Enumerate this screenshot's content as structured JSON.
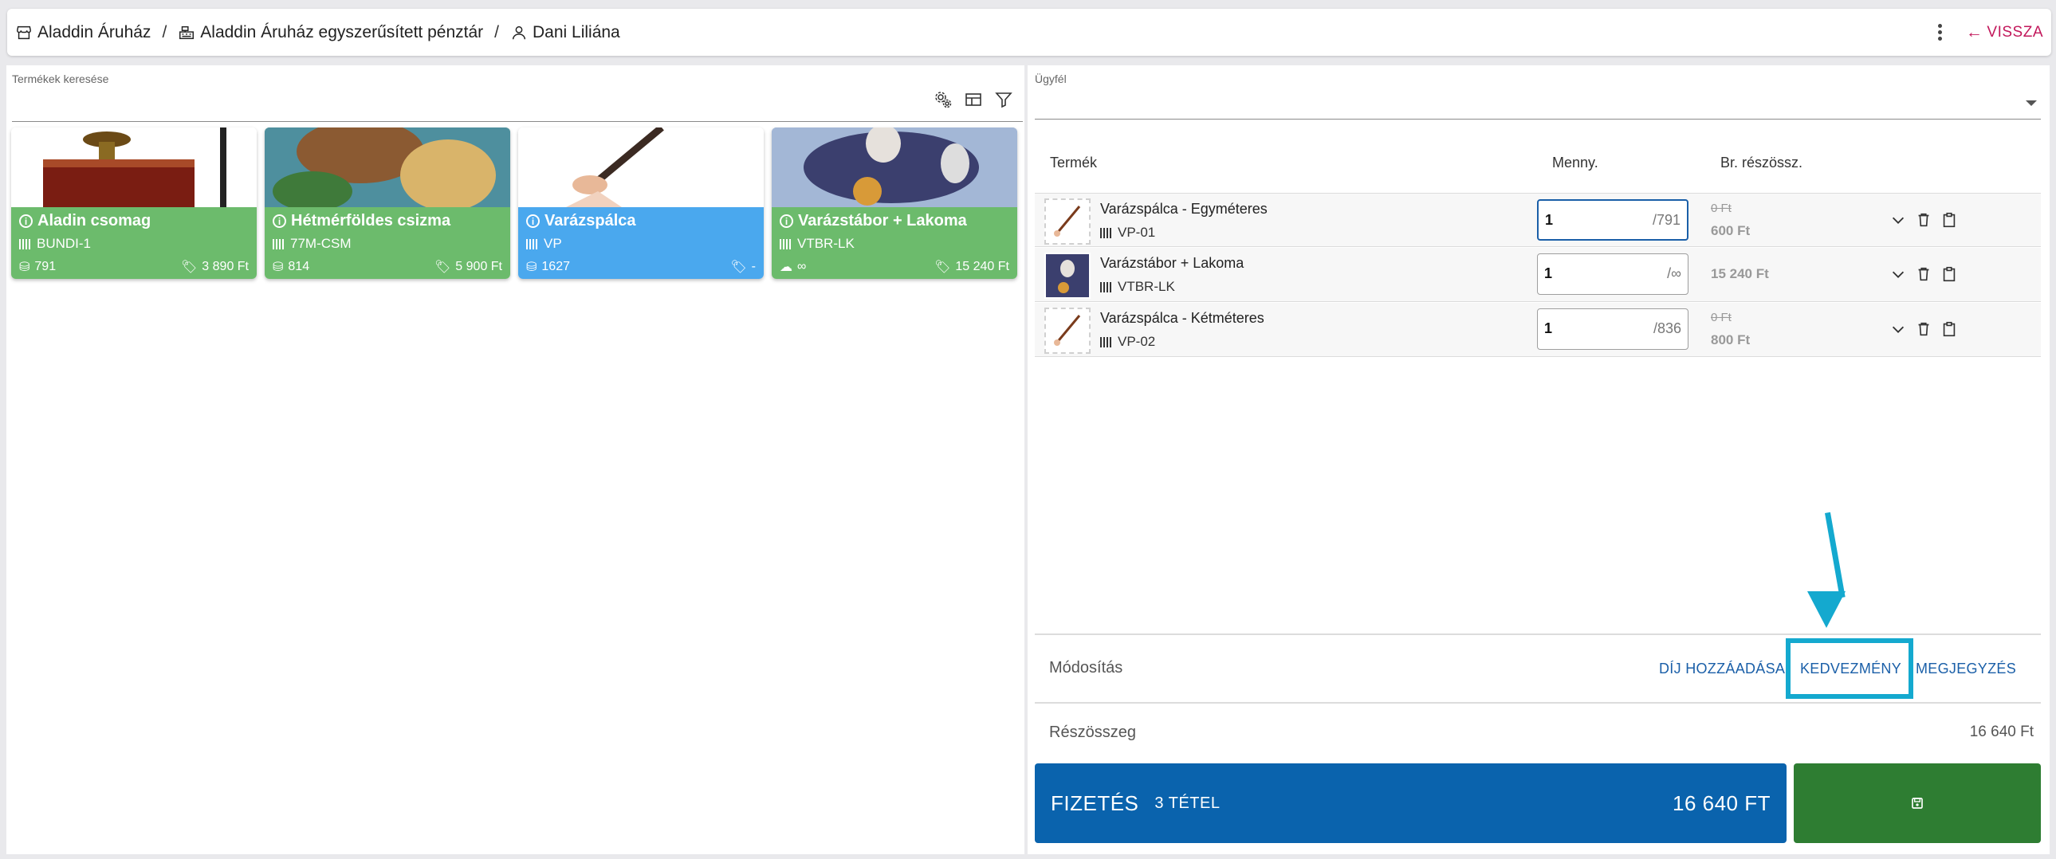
{
  "breadcrumb": {
    "store": "Aladdin Áruház",
    "register": "Aladdin Áruház egyszerűsített pénztár",
    "user": "Dani Liliána",
    "separator": "/"
  },
  "header": {
    "back_label": "VISSZA"
  },
  "search": {
    "label": "Termékek keresése",
    "value": ""
  },
  "products": [
    {
      "name": "Aladin csomag",
      "sku": "BUNDI-1",
      "stock": "791",
      "price": "3 890 Ft",
      "color": "#6cbb6c"
    },
    {
      "name": "Hétmérföldes csizma",
      "sku": "77M-CSM",
      "stock": "814",
      "price": "5 900 Ft",
      "color": "#6cbb6c"
    },
    {
      "name": "Varázspálca",
      "sku": "VP",
      "stock": "1627",
      "price": "-",
      "color": "#4aa8ee"
    },
    {
      "name": "Varázstábor + Lakoma",
      "sku": "VTBR-LK",
      "stock": "∞",
      "price": "15 240 Ft",
      "color": "#6cbb6c"
    }
  ],
  "client": {
    "label": "Ügyfél",
    "value": ""
  },
  "table": {
    "col_product": "Termék",
    "col_qty": "Menny.",
    "col_subtotal": "Br. részössz."
  },
  "lines": [
    {
      "name": "Varázspálca - Egyméteres",
      "sku": "VP-01",
      "qty": "1",
      "max": "/791",
      "old_price": "0 Ft",
      "price": "600 Ft"
    },
    {
      "name": "Varázstábor + Lakoma",
      "sku": "VTBR-LK",
      "qty": "1",
      "max": "/∞",
      "old_price": "",
      "price": "15 240 Ft"
    },
    {
      "name": "Varázspálca - Kétméteres",
      "sku": "VP-02",
      "qty": "1",
      "max": "/836",
      "old_price": "0 Ft",
      "price": "800 Ft"
    }
  ],
  "modify": {
    "label": "Módosítás",
    "add_fee": "DÍJ HOZZÁADÁSA",
    "discount": "KEDVEZMÉNY",
    "note": "MEGJEGYZÉS"
  },
  "subtotal": {
    "label": "Részösszeg",
    "value": "16 640 Ft"
  },
  "pay": {
    "label": "FIZETÉS",
    "count": "3 TÉTEL",
    "amount": "16 640 FT"
  },
  "colors": {
    "accent": "#0a63ad",
    "save": "#2e7d32",
    "highlight": "#14a9cf",
    "back": "#c2185b"
  }
}
